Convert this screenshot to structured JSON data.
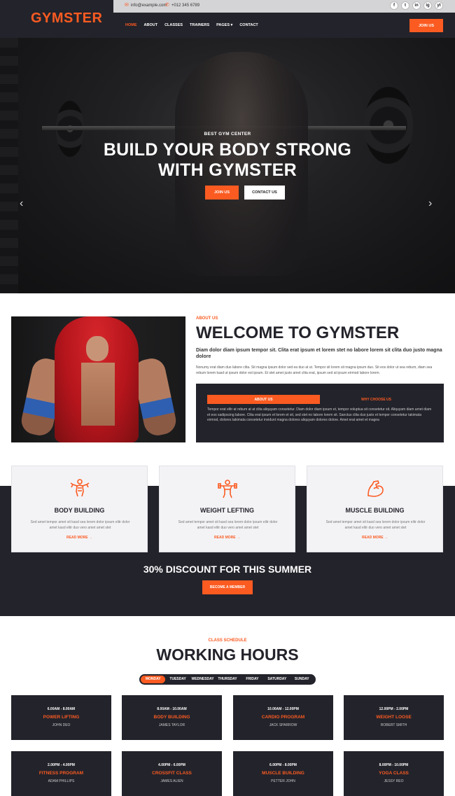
{
  "header": {
    "logo": "GYMSTER",
    "email": "info@example.com",
    "phone": "+012 345 6789",
    "socials": [
      "f",
      "t",
      "in",
      "ig",
      "yt"
    ],
    "nav": [
      "HOME",
      "ABOUT",
      "CLASSES",
      "TRAINERS",
      "PAGES ▾",
      "CONTACT"
    ],
    "join_label": "JOIN US"
  },
  "hero": {
    "subtitle": "BEST GYM CENTER",
    "title_line1": "BUILD YOUR BODY STRONG",
    "title_line2": "WITH GYMSTER",
    "primary_btn": "JOIN US",
    "secondary_btn": "CONTACT US",
    "prev_arrow": "‹",
    "next_arrow": "›"
  },
  "about": {
    "label": "ABOUT US",
    "title": "WELCOME TO GYMSTER",
    "lead": "Diam dolor diam ipsum tempor sit. Clita erat ipsum et lorem stet no labore lorem sit clita duo justo magna dolore",
    "body": "Nonumy erat diam duo labore clita. Sit magna ipsum dolor sed ea duo at ut. Tempor sit lorem sit magna ipsum duo. Sit eos dolor ut sea rebum, diam sea rebum lorem kasd ut ipsum dolor est ipsum. Et stet amet justo amet clita erat, ipsum sed at ipsum eirmod labore lorem.",
    "tab_active": "ABOUT US",
    "tab_inactive": "WHY CHOOSE US",
    "box_text": "Tempor erat elitr at rebum at at clita aliquyam consetetur. Diam dolor diam ipsum et, tempor voluptua sit consetetur sit. Aliquyam diam amet diam et eos sadipscing labore. Clita erat ipsum et lorem et sit, sed stet no labore lorem sit. Sanctus clita duo justo et tempor consetetur takimata eirmod, dolores takimata consetetur invidunt magna dolores aliquyam dolores dolore. Amet erat amet et magna"
  },
  "services": [
    {
      "name": "BODY BUILDING",
      "desc": "Sed amet tempor amet sit kasd sea lorem dolor ipsum elitr dolor amet kasd elitr duo vero amet amet stet",
      "more": "READ MORE →",
      "icon": "body-building-icon"
    },
    {
      "name": "WEIGHT LEFTING",
      "desc": "Sed amet tempor amet sit kasd sea lorem dolor ipsum elitr dolor amet kasd elitr duo vero amet amet stet",
      "more": "READ MORE →",
      "icon": "weight-lifting-icon"
    },
    {
      "name": "MUSCLE BUILDING",
      "desc": "Sed amet tempor amet sit kasd sea lorem dolor ipsum elitr dolor amet kasd elitr duo vero amet amet stet",
      "more": "READ MORE →",
      "icon": "muscle-arm-icon"
    }
  ],
  "promo": {
    "title": "30% DISCOUNT FOR THIS SUMMER",
    "button": "BECOME A MEMBER"
  },
  "schedule": {
    "label": "CLASS SCHEDULE",
    "title": "WORKING HOURS",
    "days": [
      "MONDAY",
      "TUESDAY",
      "WEDNESDAY",
      "THURSDAY",
      "FRIDAY",
      "SATURDAY",
      "SUNDAY"
    ],
    "active_day": "MONDAY",
    "classes": [
      {
        "time": "6.00AM - 8.00AM",
        "name": "POWER LIFTING",
        "trainer": "JOHN DEO"
      },
      {
        "time": "8.00AM - 10.00AM",
        "name": "BODY BUILDING",
        "trainer": "JAMES TAYLOR"
      },
      {
        "time": "10.00AM - 12.00PM",
        "name": "CARDIO PROGRAM",
        "trainer": "JACK SPARROW"
      },
      {
        "time": "12.00PM - 2.00PM",
        "name": "WEIGHT LOOSE",
        "trainer": "ROBERT SMITH"
      },
      {
        "time": "2.00PM - 4.00PM",
        "name": "FITNESS PROGRAM",
        "trainer": "ADAM PHILLIPS"
      },
      {
        "time": "4.00PM - 6.00PM",
        "name": "CROSSFIT CLASS",
        "trainer": "JAMES ALIEN"
      },
      {
        "time": "6.00PM - 8.00PM",
        "name": "MUSCLE BUILDING",
        "trainer": "PETTER JOHN"
      },
      {
        "time": "8.00PM - 10.00PM",
        "name": "YOGA CLASS",
        "trainer": "JESSY REO"
      }
    ]
  },
  "colors": {
    "accent": "#fb5b21",
    "dark": "#23232b",
    "light_card": "#f3f3f6"
  }
}
